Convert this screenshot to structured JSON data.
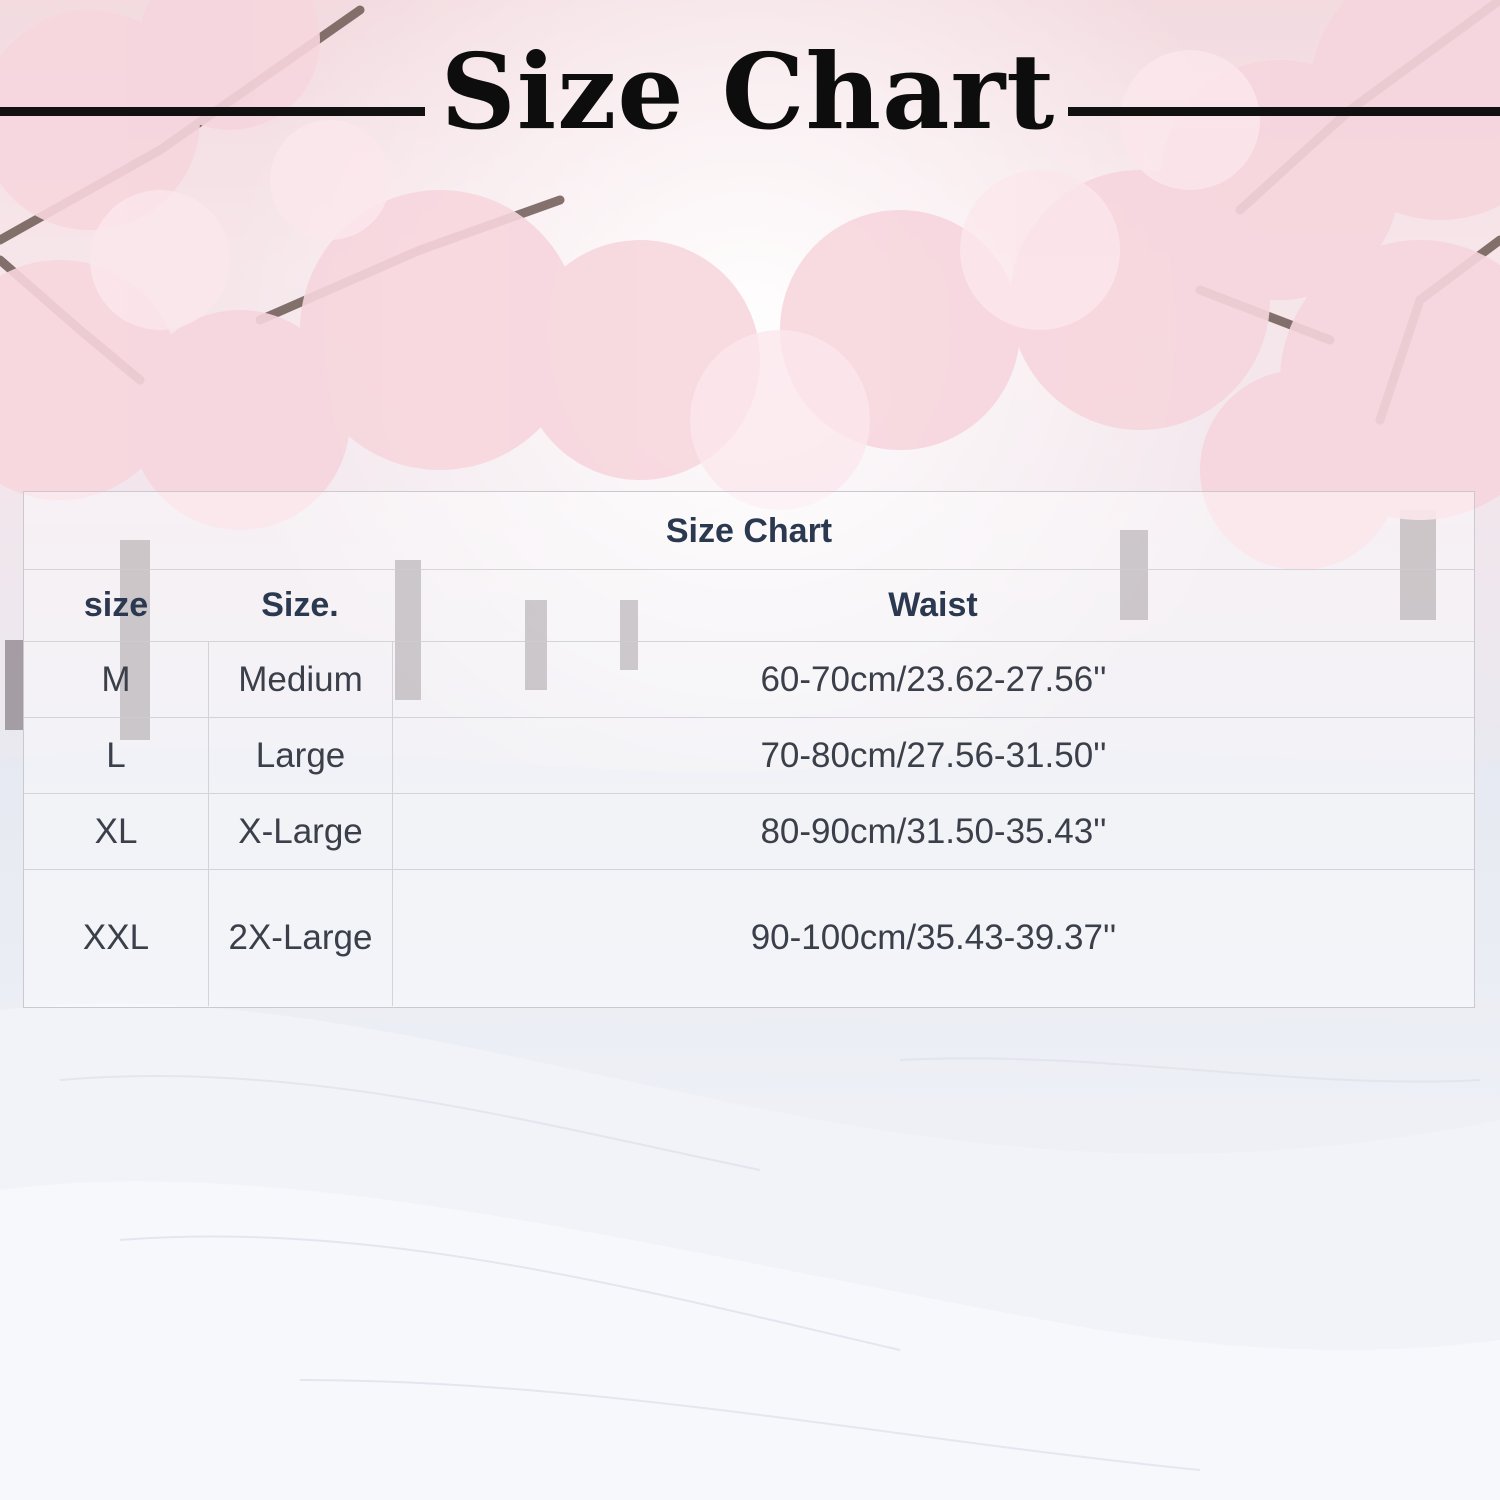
{
  "page": {
    "title": "Size Chart"
  },
  "table": {
    "caption": "Size Chart",
    "headers": [
      "size",
      "Size.",
      "Waist"
    ],
    "rows": [
      {
        "size": "M",
        "name": "Medium",
        "waist": "60-70cm/23.62-27.56''"
      },
      {
        "size": "L",
        "name": "Large",
        "waist": "70-80cm/27.56-31.50''"
      },
      {
        "size": "XL",
        "name": "X-Large",
        "waist": "80-90cm/31.50-35.43''"
      },
      {
        "size": "XXL",
        "name": "2X-Large",
        "waist": "90-100cm/35.43-39.37''"
      }
    ]
  },
  "colors": {
    "title": "#0d0d0d",
    "header_text": "#2a3850",
    "body_text": "#3a3f4a",
    "blossom": "#f7d6de",
    "snow": "#f4f5f9"
  }
}
